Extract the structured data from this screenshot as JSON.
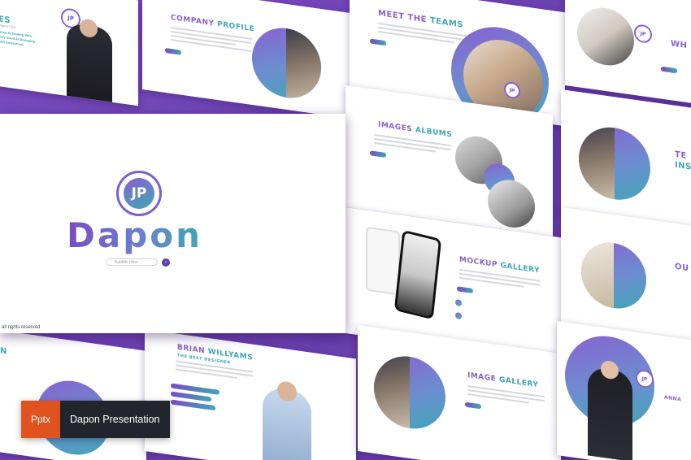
{
  "main_slide": {
    "logo_glyph": "JP",
    "brand_name": "Dapon",
    "search_placeholder": "Subtitle Here",
    "rights": "all rights reserved"
  },
  "slides": {
    "ceo": {
      "title_fragment": "ES",
      "quote_1": "Great At Dealing With",
      "quote_2": "Very Good At Managing",
      "quote_3": "with Enterprise!",
      "role": "Dapon CEO"
    },
    "company_profile": {
      "title_a": "COMPANY",
      "title_b": "PROFILE"
    },
    "meet_teams": {
      "title_a": "MEET THE",
      "title_b": "TEAMS"
    },
    "right_top": {
      "title_fragment": "WH"
    },
    "images_albums": {
      "title_a": "IMAGES",
      "title_b": "ALBUMS"
    },
    "right_mid": {
      "title_fragment_1": "TE",
      "title_fragment_2": "INS"
    },
    "mockup_gallery": {
      "title_a": "MOCKUP",
      "title_b": "GALLERY"
    },
    "right_low": {
      "title_fragment": "OU"
    },
    "left_bottom": {
      "title_fragment": "N"
    },
    "brian": {
      "title_a": "BRIAN",
      "title_b": "WILLYAMS",
      "subtitle": "THE BEST DESIGNER"
    },
    "image_gallery": {
      "title_a": "IMAGE",
      "title_b": "GALLERY"
    },
    "right_bottom": {
      "title_fragment": "ANNA"
    }
  },
  "badge": {
    "format": "Pptx",
    "name": "Dapon Presentation"
  },
  "colors": {
    "purple": "#7a4cc0",
    "teal": "#3ea7b5",
    "badge_orange": "#e0531f",
    "badge_dark": "#22262c"
  }
}
